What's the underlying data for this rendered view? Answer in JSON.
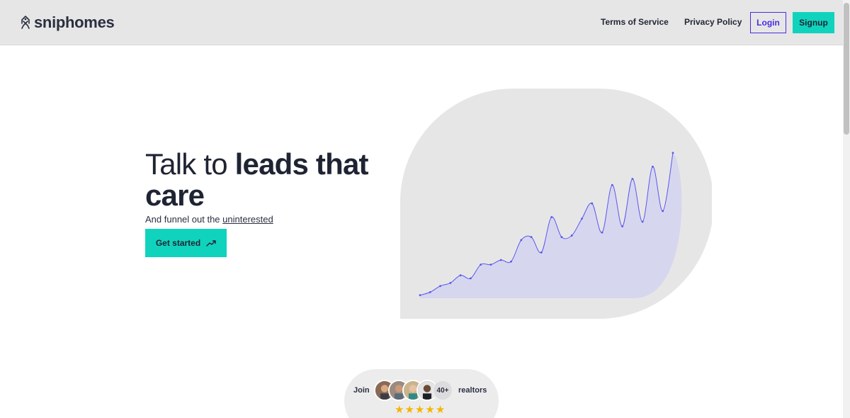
{
  "header": {
    "brand": "sniphomes",
    "brand_icon": "house-key-icon",
    "nav": {
      "terms": "Terms of Service",
      "privacy": "Privacy Policy",
      "login": "Login",
      "signup": "Signup"
    }
  },
  "hero": {
    "title_light": "Talk to ",
    "title_bold": "leads that care",
    "subtitle_prefix": "And funnel out the ",
    "subtitle_underlined": "uninterested",
    "cta_label": "Get started",
    "cta_icon": "trending-up-icon"
  },
  "chart_data": {
    "type": "area",
    "values": [
      2,
      4,
      8,
      10,
      15,
      13,
      22,
      22,
      25,
      24,
      38,
      40,
      30,
      53,
      40,
      41,
      52,
      62,
      43,
      74,
      47,
      78,
      50,
      86,
      57,
      95
    ]
  },
  "social_proof": {
    "join": "Join",
    "count": "40+",
    "realtors": "realtors",
    "rating": 5
  },
  "colors": {
    "accent": "#10d3bd",
    "login_border": "#4b2be0",
    "chart_line": "#5b55f0",
    "chart_fill": "#d6d7ee",
    "star": "#f5b400"
  }
}
